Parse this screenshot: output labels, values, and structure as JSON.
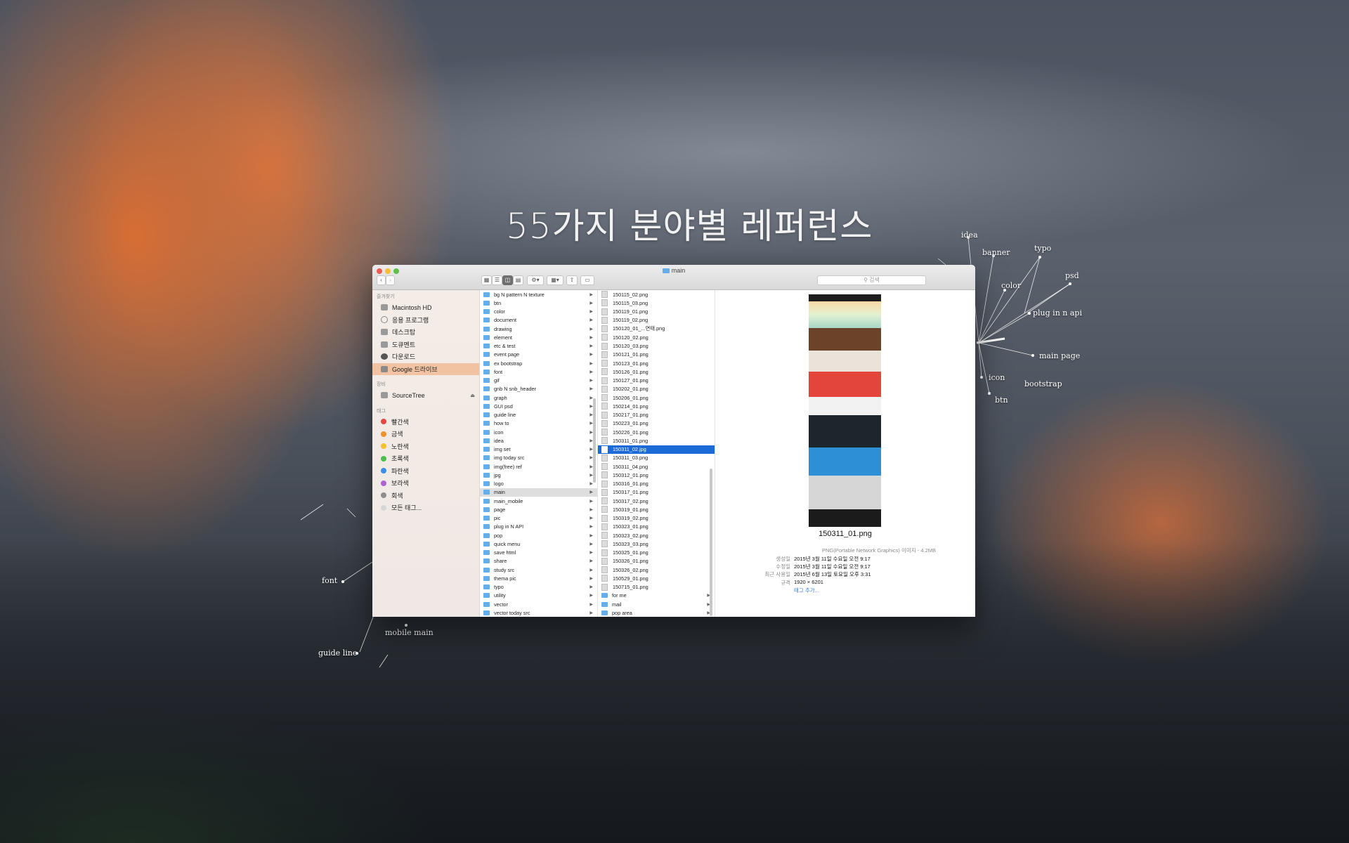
{
  "headline": "55가지 분야별 레퍼런스",
  "annotations": {
    "idea": "idea",
    "banner": "banner",
    "typo": "typo",
    "psd": "psd",
    "color": "color",
    "plug_in_n_api": "plug in n api",
    "main_page": "main page",
    "icon": "icon",
    "bootstrap": "bootstrap",
    "btn": "btn",
    "font": "font",
    "mobile_main": "mobile main",
    "guide_line": "guide line"
  },
  "window": {
    "title": "main",
    "search_placeholder": "검색"
  },
  "sidebar": {
    "favorites_header": "즐겨찾기",
    "favorites": [
      {
        "label": "Macintosh HD",
        "icon": "hard-drive-icon"
      },
      {
        "label": "응용 프로그램",
        "icon": "applications-icon"
      },
      {
        "label": "데스크탑",
        "icon": "desktop-icon"
      },
      {
        "label": "도큐멘트",
        "icon": "documents-icon"
      },
      {
        "label": "다운로드",
        "icon": "downloads-icon"
      },
      {
        "label": "Google 드라이브",
        "icon": "google-drive-icon",
        "selected": true
      }
    ],
    "devices_header": "장비",
    "devices": [
      {
        "label": "SourceTree",
        "icon": "drive-icon"
      }
    ],
    "tags_header": "태그",
    "tags": [
      {
        "label": "빨간색",
        "color": "#e8463f"
      },
      {
        "label": "금색",
        "color": "#f0922b"
      },
      {
        "label": "노란색",
        "color": "#f2c12e"
      },
      {
        "label": "초록색",
        "color": "#4cbf4a"
      },
      {
        "label": "파란색",
        "color": "#3b8ee8"
      },
      {
        "label": "보라색",
        "color": "#b361d6"
      },
      {
        "label": "회색",
        "color": "#8e8e8e"
      },
      {
        "label": "모든 태그...",
        "color": "#d6d6d6"
      }
    ]
  },
  "column1": {
    "items": [
      "bg N pattern N texture",
      "btn",
      "color",
      "document",
      "drawing",
      "element",
      "etc & test",
      "event page",
      "ex bootstrap",
      "font",
      "gif",
      "gnb N snb_header",
      "graph",
      "GUI psd",
      "guide line",
      "how to",
      "icon",
      "idea",
      "img set",
      "img today src",
      "img(free) ref",
      "jpg",
      "logo",
      "main",
      "main_mobile",
      "page",
      "pic",
      "plug in N API",
      "pop",
      "quick menu",
      "save html",
      "share",
      "study src",
      "thema pic",
      "typo",
      "utility",
      "vector",
      "vector today src"
    ],
    "selected": "main"
  },
  "column2": {
    "files": [
      "150115_02.png",
      "150115_03.png",
      "150119_01.png",
      "150119_02.png",
      "150120_01_...연태.png",
      "150120_02.png",
      "150120_03.png",
      "150121_01.png",
      "150123_01.png",
      "150126_01.png",
      "150127_01.png",
      "150202_01.png",
      "150206_01.png",
      "150214_01.png",
      "150217_01.png",
      "150223_01.png",
      "150226_01.png",
      "150311_01.png",
      "150311_02.jpg",
      "150311_03.png",
      "150311_04.png",
      "150312_01.png",
      "150316_01.png",
      "150317_01.png",
      "150317_02.png",
      "150319_01.png",
      "150319_02.png",
      "150323_01.png",
      "150323_02.png",
      "150323_03.png",
      "150325_01.png",
      "150326_01.png",
      "150326_02.png",
      "150529_01.png",
      "150715_01.png"
    ],
    "folders": [
      "for me",
      "mail",
      "pop area"
    ],
    "selected": "150311_02.jpg"
  },
  "preview": {
    "filename": "150311_01.png",
    "type": "PNG(Portable Network Graphics) 이미지 - 4.2MB",
    "meta": [
      {
        "label": "생성일",
        "value": "2015년 3월 11일 수요일 오전 9:17"
      },
      {
        "label": "수정일",
        "value": "2015년 3월 11일 수요일 오전 9:17"
      },
      {
        "label": "최근 사용일",
        "value": "2015년 6월 13일 토요일 오후 3:31"
      },
      {
        "label": "규격",
        "value": "1920 × 6201"
      }
    ],
    "add_tag": "태그 추가..."
  }
}
